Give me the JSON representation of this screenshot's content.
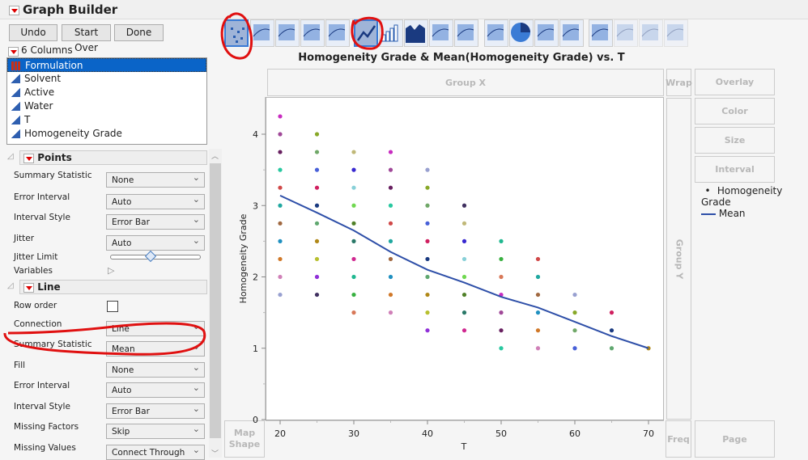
{
  "window": {
    "title": "Graph Builder"
  },
  "buttons": {
    "undo": "Undo",
    "start_over": "Start Over",
    "done": "Done"
  },
  "columns": {
    "header": "6 Columns",
    "items": [
      {
        "label": "Formulation",
        "type": "nominal",
        "selected": true
      },
      {
        "label": "Solvent",
        "type": "continuous"
      },
      {
        "label": "Active",
        "type": "continuous"
      },
      {
        "label": "Water",
        "type": "continuous"
      },
      {
        "label": "T",
        "type": "continuous"
      },
      {
        "label": "Homogeneity Grade",
        "type": "continuous"
      }
    ]
  },
  "points_section": {
    "title": "Points",
    "rows": [
      {
        "label": "Summary Statistic",
        "value": "None"
      },
      {
        "label": "Error Interval",
        "value": "Auto"
      },
      {
        "label": "Interval Style",
        "value": "Error Bar"
      },
      {
        "label": "Jitter",
        "value": "Auto"
      }
    ],
    "jitter_limit_label": "Jitter Limit",
    "jitter_limit_value": 0.45,
    "variables_label": "Variables"
  },
  "line_section": {
    "title": "Line",
    "row_order_label": "Row order",
    "row_order_checked": false,
    "rows": [
      {
        "label": "Connection",
        "value": "Line"
      },
      {
        "label": "Summary Statistic",
        "value": "Mean"
      },
      {
        "label": "Fill",
        "value": "None"
      },
      {
        "label": "Error Interval",
        "value": "Auto"
      },
      {
        "label": "Interval Style",
        "value": "Error Bar"
      },
      {
        "label": "Missing Factors",
        "value": "Skip"
      },
      {
        "label": "Missing Values",
        "value": "Connect Through"
      }
    ]
  },
  "toolbar": {
    "icons": [
      "points",
      "smoother",
      "line-of-fit",
      "ellipse",
      "contour",
      "line",
      "bar",
      "area",
      "box-plot",
      "histogram",
      "heatmap",
      "pie",
      "treemap",
      "mosaic",
      "caption-box",
      "formula",
      "map-shapes",
      "parallel"
    ],
    "selected": [
      "points",
      "line"
    ]
  },
  "zones": {
    "group_x": "Group X",
    "group_y": "Group Y",
    "wrap": "Wrap",
    "overlay": "Overlay",
    "color": "Color",
    "size": "Size",
    "interval": "Interval",
    "map_shape": "Map Shape",
    "freq": "Freq",
    "page": "Page"
  },
  "legend": {
    "items": [
      {
        "label": "Homogeneity Grade",
        "marker": "dot"
      },
      {
        "label": "Mean",
        "marker": "line"
      }
    ]
  },
  "colors": {
    "accent": "#0a64c8",
    "line": "#2e4fa8",
    "annotation": "#e01010"
  },
  "chart_data": {
    "type": "scatter+line",
    "title": "Homogeneity Grade & Mean(Homogeneity Grade) vs. T",
    "xlabel": "T",
    "ylabel": "Homogeneity Grade",
    "xlim": [
      18,
      72
    ],
    "ylim": [
      0,
      4.4
    ],
    "xticks": [
      20,
      30,
      40,
      50,
      60,
      70
    ],
    "yticks": [
      0,
      1,
      2,
      3,
      4
    ],
    "grid": false,
    "points_by_x": [
      {
        "x": 20,
        "y": [
          4.25,
          4,
          3.75,
          3.5,
          3.25,
          3,
          2.75,
          2.5,
          2.25,
          2,
          1.75
        ]
      },
      {
        "x": 25,
        "y": [
          4,
          3.75,
          3.5,
          3.25,
          3,
          2.75,
          2.5,
          2.25,
          2,
          1.75
        ]
      },
      {
        "x": 30,
        "y": [
          3.75,
          3.5,
          3.25,
          3,
          2.75,
          2.5,
          2.25,
          2,
          1.75,
          1.5
        ]
      },
      {
        "x": 35,
        "y": [
          3.75,
          3.5,
          3.25,
          3,
          2.75,
          2.5,
          2.25,
          2,
          1.75,
          1.5
        ]
      },
      {
        "x": 40,
        "y": [
          3.5,
          3.25,
          3,
          2.75,
          2.5,
          2.25,
          2,
          1.75,
          1.5,
          1.25
        ]
      },
      {
        "x": 45,
        "y": [
          3,
          2.75,
          2.5,
          2.25,
          2,
          1.75,
          1.5,
          1.25
        ]
      },
      {
        "x": 50,
        "y": [
          2.5,
          2.25,
          2,
          1.75,
          1.5,
          1.25,
          1
        ]
      },
      {
        "x": 55,
        "y": [
          2.25,
          2,
          1.75,
          1.5,
          1.25,
          1
        ]
      },
      {
        "x": 60,
        "y": [
          1.75,
          1.5,
          1.25,
          1
        ]
      },
      {
        "x": 65,
        "y": [
          1.5,
          1.25,
          1
        ]
      },
      {
        "x": 70,
        "y": [
          1
        ]
      }
    ],
    "mean_series": {
      "name": "Mean",
      "x": [
        20,
        25,
        30,
        35,
        40,
        45,
        50,
        55,
        60,
        65,
        70
      ],
      "y": [
        3.14,
        2.9,
        2.65,
        2.35,
        2.1,
        1.92,
        1.72,
        1.57,
        1.37,
        1.17,
        1.0
      ]
    },
    "palette": [
      "#c82cc0",
      "#d080b8",
      "#b8c030",
      "#d02890",
      "#20a8a0",
      "#d02060",
      "#88d0d8",
      "#a04898",
      "#98a0d0",
      "#9030d8",
      "#20b890",
      "#a06840",
      "#1a3a80",
      "#70d850",
      "#682060",
      "#88a828",
      "#403060",
      "#38b040",
      "#2090c0",
      "#60a870",
      "#508028",
      "#28c8a0",
      "#70a868",
      "#c0b878",
      "#d87858",
      "#d07828",
      "#b08818",
      "#2a7868",
      "#d04848",
      "#4860d8",
      "#3828d0"
    ]
  }
}
